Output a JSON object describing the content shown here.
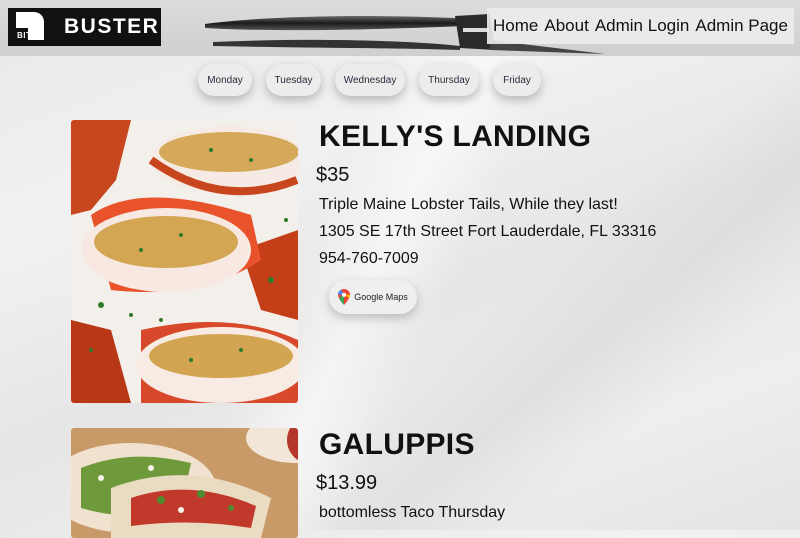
{
  "brand": {
    "logo_small": "BITE",
    "name": "BUSTER"
  },
  "nav": {
    "items": [
      "Home",
      "About",
      "Admin Login",
      "Admin Page"
    ]
  },
  "days": [
    "Monday",
    "Tuesday",
    "Wednesday",
    "Thursday",
    "Friday"
  ],
  "restaurants": [
    {
      "name": "KELLY'S LANDING",
      "price": "$35",
      "deal": "Triple Maine Lobster Tails, While they last!",
      "address": "1305 SE 17th Street Fort Lauderdale, FL 33316",
      "phone": "954-760-7009",
      "maps_label": "Google Maps",
      "photo": "lobster-tails-photo"
    },
    {
      "name": "GALUPPIS",
      "price": "$13.99",
      "deal": "bottomless Taco Thursday",
      "photo": "tacos-photo"
    }
  ],
  "colors": {
    "header_bg": "#d4d4d4",
    "logo_bg": "#111111",
    "pill_bg": "#ececec",
    "page_bg": "#ebebeb"
  }
}
